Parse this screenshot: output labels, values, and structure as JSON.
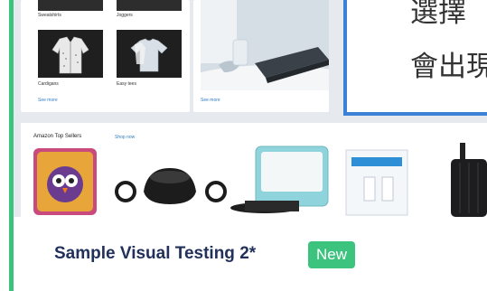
{
  "card": {
    "title": "Sample Visual Testing 2*",
    "badge": "New"
  },
  "preview": {
    "panel_left": {
      "labels_top": [
        "Sweatshirts",
        "Joggers"
      ],
      "labels_bottom": [
        "Cardigans",
        "Easy tees"
      ],
      "see_more": "See more"
    },
    "panel_right": {
      "see_more": "See more"
    },
    "overlay": {
      "line1": "選擇",
      "line2": "會出現"
    },
    "sellers": {
      "title": "Amazon Top Sellers",
      "link": "Shop now"
    }
  },
  "colors": {
    "accent": "#3cc37e",
    "title": "#22315b",
    "overlay_border": "#3b82d6"
  }
}
